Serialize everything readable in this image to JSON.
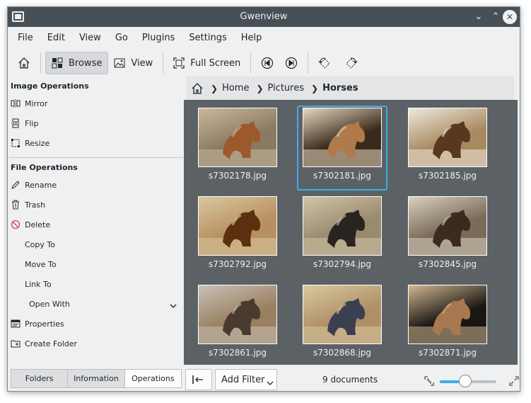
{
  "window": {
    "title": "Gwenview"
  },
  "menubar": [
    "File",
    "Edit",
    "View",
    "Go",
    "Plugins",
    "Settings",
    "Help"
  ],
  "toolbar": {
    "browse": "Browse",
    "view": "View",
    "fullscreen": "Full Screen"
  },
  "sidebar": {
    "image_ops_title": "Image Operations",
    "image_ops": [
      "Mirror",
      "Flip",
      "Resize"
    ],
    "file_ops_title": "File Operations",
    "file_ops": [
      "Rename",
      "Trash",
      "Delete",
      "Copy To",
      "Move To",
      "Link To",
      "Open With",
      "Properties",
      "Create Folder"
    ]
  },
  "bottom_tabs": [
    "Folders",
    "Information",
    "Operations"
  ],
  "breadcrumb": [
    "Home",
    "Pictures",
    "Horses"
  ],
  "thumbnails": [
    {
      "name": "s7302178.jpg",
      "selected": false,
      "bg": "#8a7a62",
      "fg": "#9c5a2c",
      "accent": "#c9b89a"
    },
    {
      "name": "s7302181.jpg",
      "selected": true,
      "bg": "#3a2a1c",
      "fg": "#b07a4a",
      "accent": "#e8d8c0"
    },
    {
      "name": "s7302185.jpg",
      "selected": false,
      "bg": "#a88a60",
      "fg": "#5a3820",
      "accent": "#f0e8dc"
    },
    {
      "name": "s7302792.jpg",
      "selected": false,
      "bg": "#b89060",
      "fg": "#5a3010",
      "accent": "#d8c8a0"
    },
    {
      "name": "s7302794.jpg",
      "selected": false,
      "bg": "#9a8a70",
      "fg": "#2a2420",
      "accent": "#d0c4a8"
    },
    {
      "name": "s7302845.jpg",
      "selected": false,
      "bg": "#7a6a58",
      "fg": "#3a2a20",
      "accent": "#d8d0c0"
    },
    {
      "name": "s7302861.jpg",
      "selected": false,
      "bg": "#9a8060",
      "fg": "#4a3a30",
      "accent": "#c8c0b8"
    },
    {
      "name": "s7302868.jpg",
      "selected": false,
      "bg": "#b09068",
      "fg": "#3a4050",
      "accent": "#d8c8a0"
    },
    {
      "name": "s7302871.jpg",
      "selected": false,
      "bg": "#1a1614",
      "fg": "#a87850",
      "accent": "#d0b890"
    }
  ],
  "statusbar": {
    "add_filter": "Add Filter",
    "doc_count": "9 documents",
    "zoom_level": 0.45
  },
  "colors": {
    "accent": "#3daee9",
    "titlebar": "#475057",
    "grid_bg": "#5c6166"
  }
}
